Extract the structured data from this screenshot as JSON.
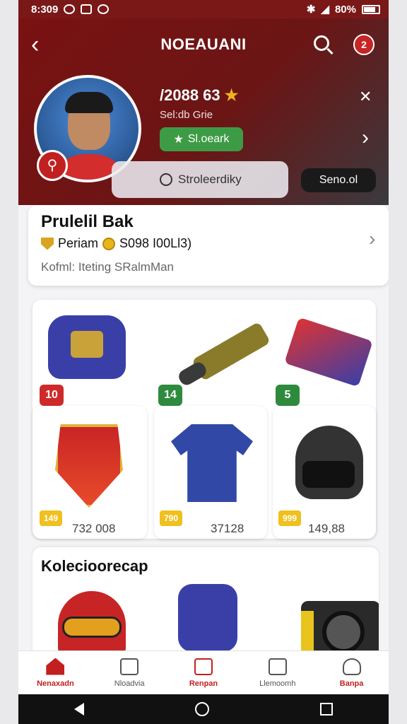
{
  "status": {
    "time": "8:309",
    "battery": "80%"
  },
  "header": {
    "title": "NOEAUANI",
    "notification_count": "2",
    "stats": "/2088 63",
    "subtitle": "Sel:db Grie",
    "green_button": "Sl.oeark",
    "glass_pill": "Stroleerdiky",
    "dark_pill": "Seno.ol"
  },
  "profile_card": {
    "title": "Prulelil Bak",
    "row_label": "Periam",
    "row_value": "S098 I00Ll3)",
    "footer": "Kofml: Iteting SRalmMan"
  },
  "items": [
    {
      "badge": "10",
      "badge_color": "#cf2a2a",
      "icon": "jersey-armor-icon"
    },
    {
      "badge": "14",
      "badge_color": "#2e8b3e",
      "icon": "gun-icon"
    },
    {
      "badge": "5",
      "badge_color": "#2e8b3e",
      "icon": "card-box-icon"
    },
    {
      "price": "149",
      "count": "732 008",
      "icon": "shield-icon"
    },
    {
      "price": "790",
      "count": "37128",
      "icon": "shirt-icon"
    },
    {
      "price": "999",
      "count": "149,88",
      "icon": "helmet-icon"
    }
  ],
  "collection": {
    "title": "Kolecioorecap"
  },
  "tabs": [
    {
      "label": "Nenaxadn",
      "icon": "home-icon"
    },
    {
      "label": "Nloadvia",
      "icon": "document-icon"
    },
    {
      "label": "Renpan",
      "icon": "cancel-box-icon"
    },
    {
      "label": "Llemoomh",
      "icon": "target-icon"
    },
    {
      "label": "Banpa",
      "icon": "profile-icon"
    }
  ]
}
